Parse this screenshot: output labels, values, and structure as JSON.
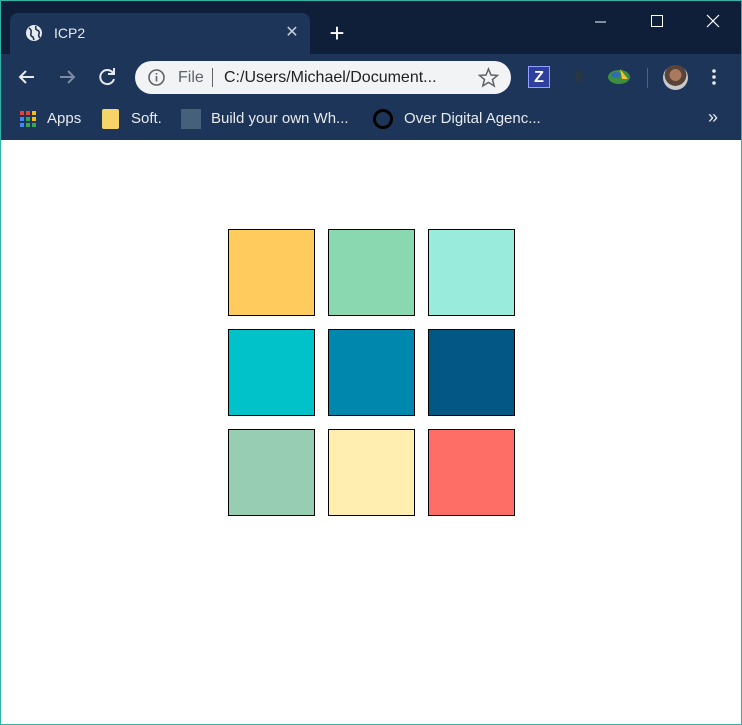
{
  "tab": {
    "title": "ICP2",
    "close_glyph": "✕",
    "favicon": "globe-icon",
    "new_tab_glyph": "+"
  },
  "omnibox": {
    "scheme_label": "File",
    "url": "C:/Users/Michael/Document..."
  },
  "extensions": {
    "z_label": "Z"
  },
  "bookmarks": {
    "items": [
      {
        "label": "Apps",
        "icon": "apps-grid-icon"
      },
      {
        "label": "Soft.",
        "icon": "folder-icon"
      },
      {
        "label": "Build your own Wh...",
        "icon": "site-thumbnail-icon"
      },
      {
        "label": "Over Digital Agenc...",
        "icon": "circle-logo-icon"
      }
    ],
    "overflow_glyph": "»"
  },
  "page": {
    "swatches": [
      {
        "color": "#ffcb5c"
      },
      {
        "color": "#8ad8b0"
      },
      {
        "color": "#99ebdb"
      },
      {
        "color": "#00c2c8"
      },
      {
        "color": "#0087ae"
      },
      {
        "color": "#025784"
      },
      {
        "color": "#97ceb3"
      },
      {
        "color": "#ffeeaf"
      },
      {
        "color": "#ff6d67"
      }
    ]
  },
  "theme": {
    "tabstrip_bg": "#0f1f3a",
    "toolbar_bg": "#1c3558",
    "window_border": "#2fb3a6"
  }
}
